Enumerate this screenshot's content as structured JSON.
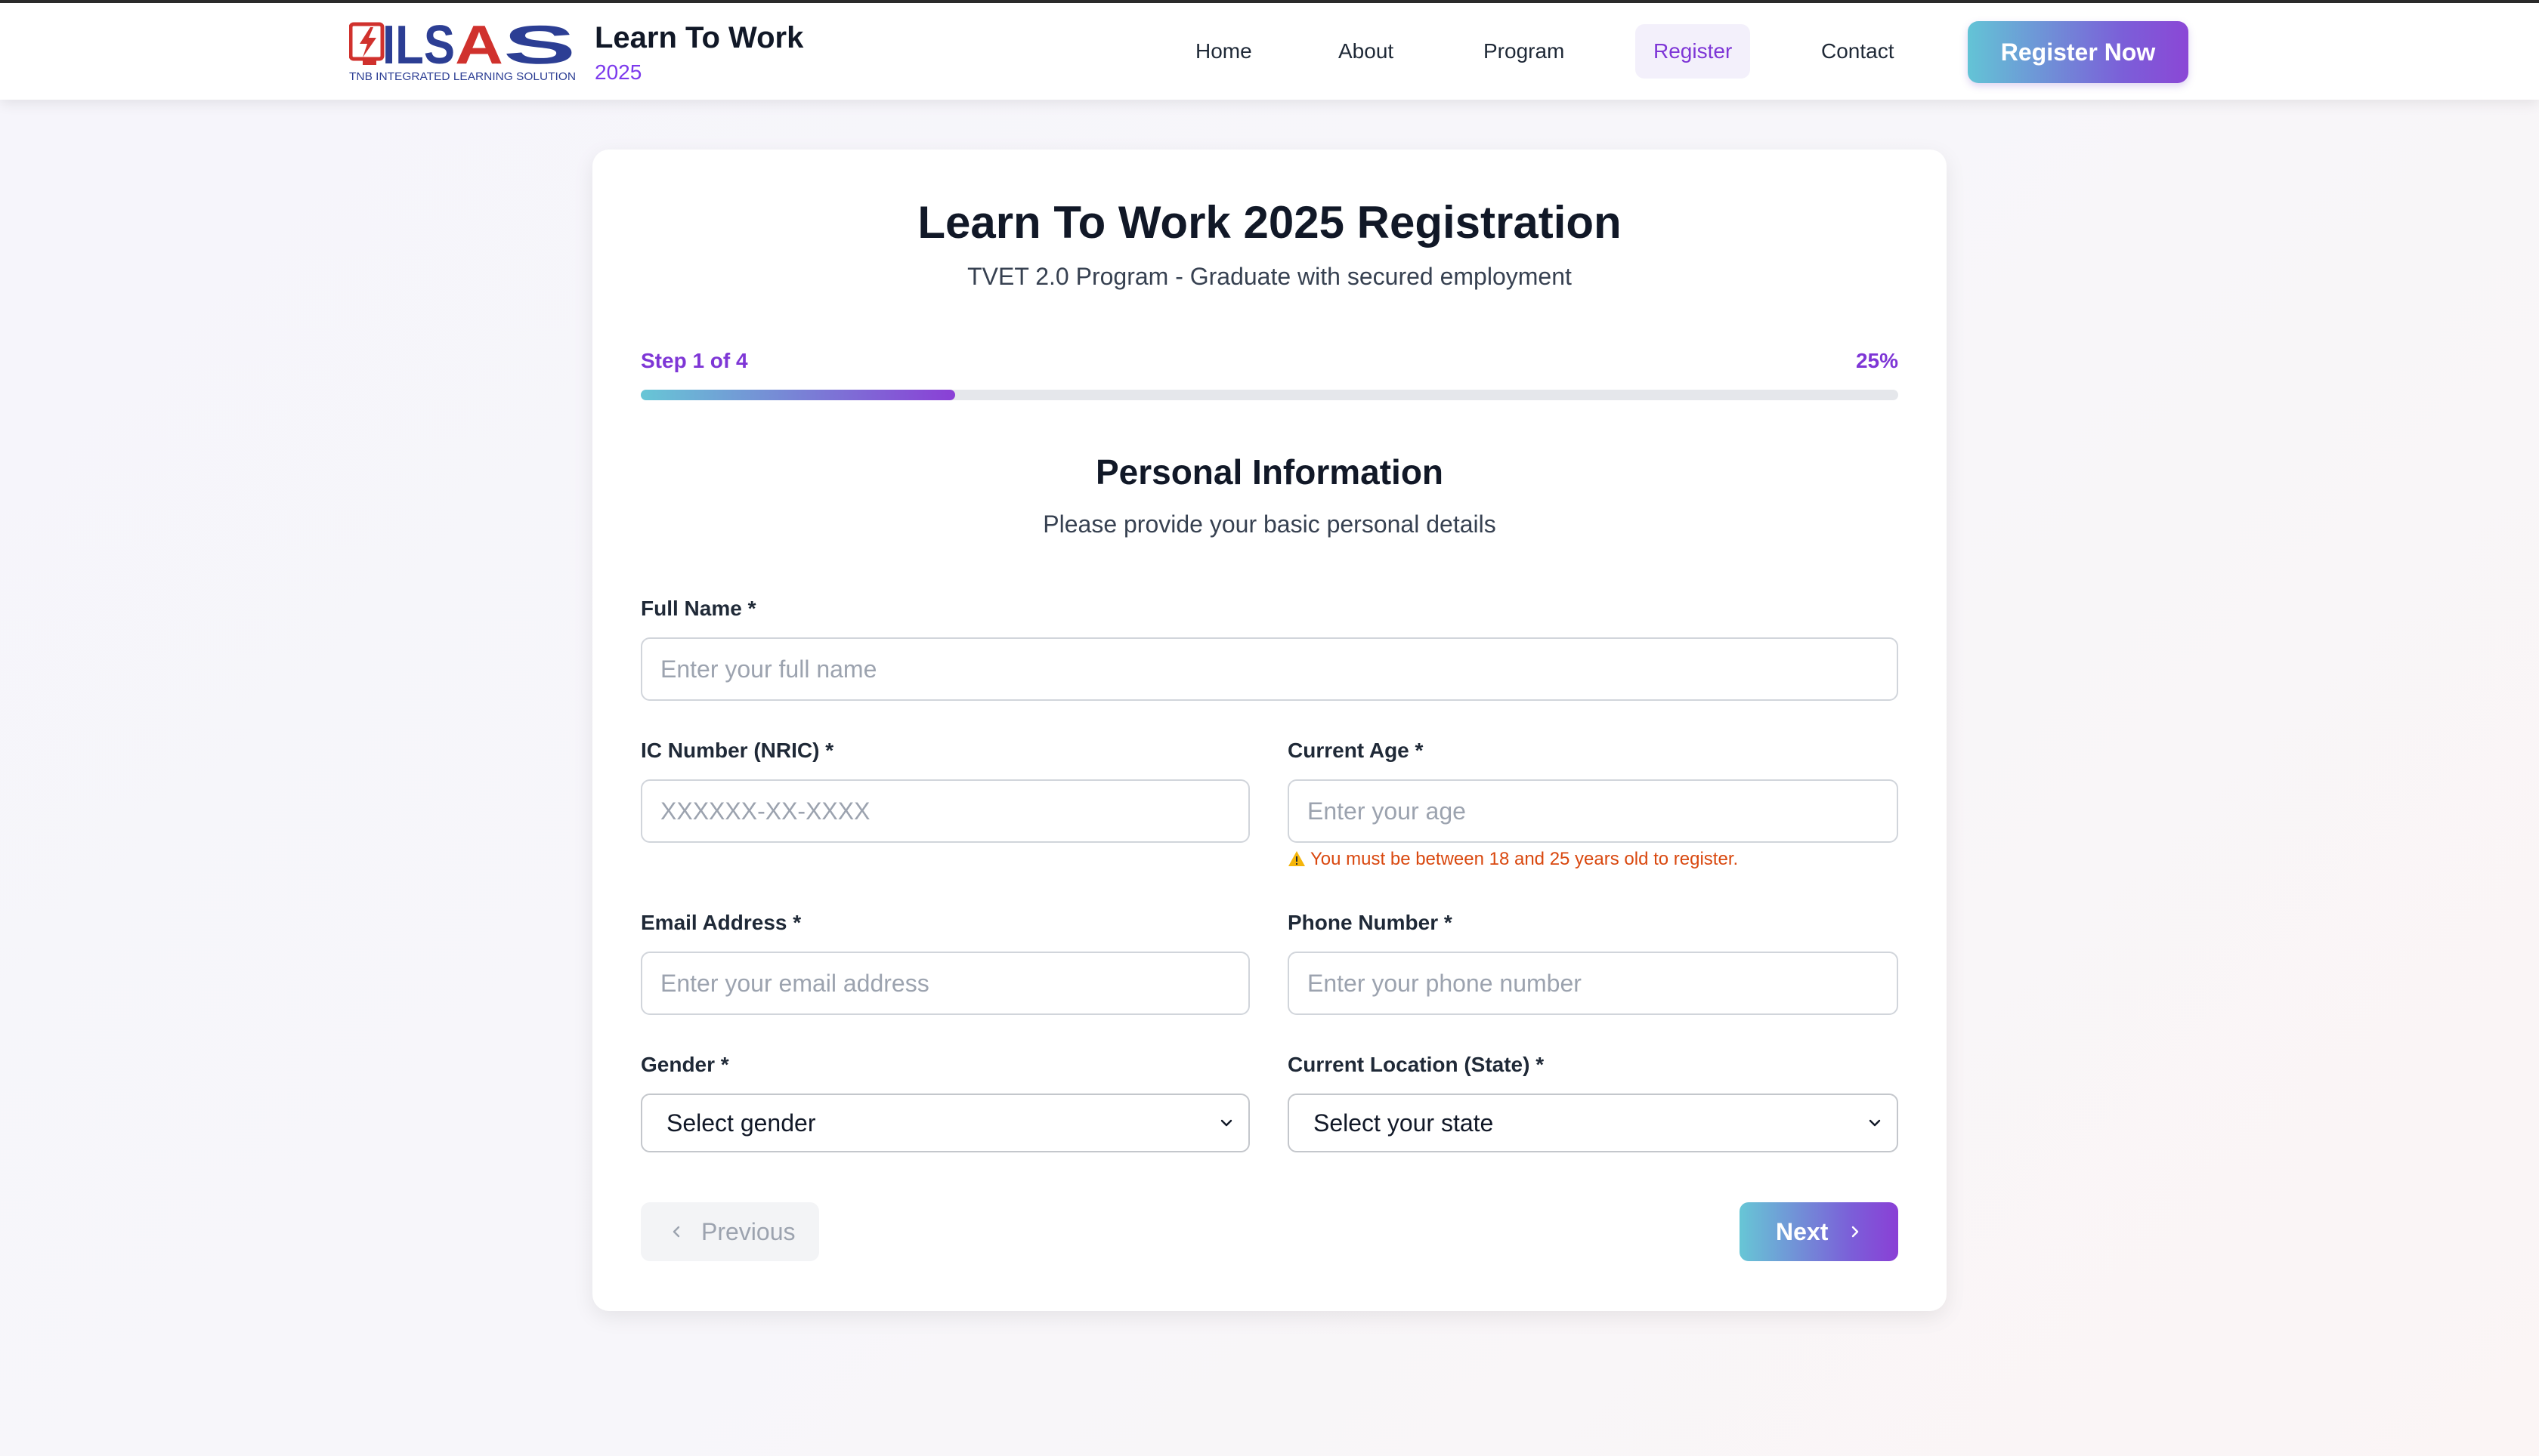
{
  "header": {
    "logo": {
      "wordmark": "ILSAS",
      "tagline": "TNB INTEGRATED LEARNING SOLUTION",
      "icon": "lightning-bolt-icon",
      "colors": {
        "red": "#d0312d",
        "blue": "#2c3e94"
      }
    },
    "brand_title": "Learn To Work",
    "brand_year": "2025",
    "nav": [
      {
        "label": "Home",
        "active": false
      },
      {
        "label": "About",
        "active": false
      },
      {
        "label": "Program",
        "active": false
      },
      {
        "label": "Register",
        "active": true
      },
      {
        "label": "Contact",
        "active": false
      }
    ],
    "cta_label": "Register Now"
  },
  "form": {
    "title": "Learn To Work 2025 Registration",
    "subtitle": "TVET 2.0 Program - Graduate with secured employment",
    "progress": {
      "step_text": "Step 1 of 4",
      "percent_text": "25%",
      "value": 0.25
    },
    "section": {
      "title": "Personal Information",
      "subtitle": "Please provide your basic personal details"
    },
    "fields": {
      "full_name": {
        "label": "Full Name *",
        "placeholder": "Enter your full name"
      },
      "ic_number": {
        "label": "IC Number (NRIC) *",
        "placeholder": "XXXXXX-XX-XXXX"
      },
      "age": {
        "label": "Current Age *",
        "placeholder": "Enter your age",
        "warning": "You must be between 18 and 25 years old to register."
      },
      "email": {
        "label": "Email Address *",
        "placeholder": "Enter your email address"
      },
      "phone": {
        "label": "Phone Number *",
        "placeholder": "Enter your phone number"
      },
      "gender": {
        "label": "Gender *",
        "selected": "Select gender"
      },
      "state": {
        "label": "Current Location (State) *",
        "selected": "Select your state"
      }
    },
    "buttons": {
      "previous": "Previous",
      "next": "Next"
    }
  },
  "colors": {
    "accent_purple": "#7e36d6",
    "gradient_start": "#67c6d6",
    "gradient_end": "#8a3fd6",
    "warning": "#d9480f"
  }
}
